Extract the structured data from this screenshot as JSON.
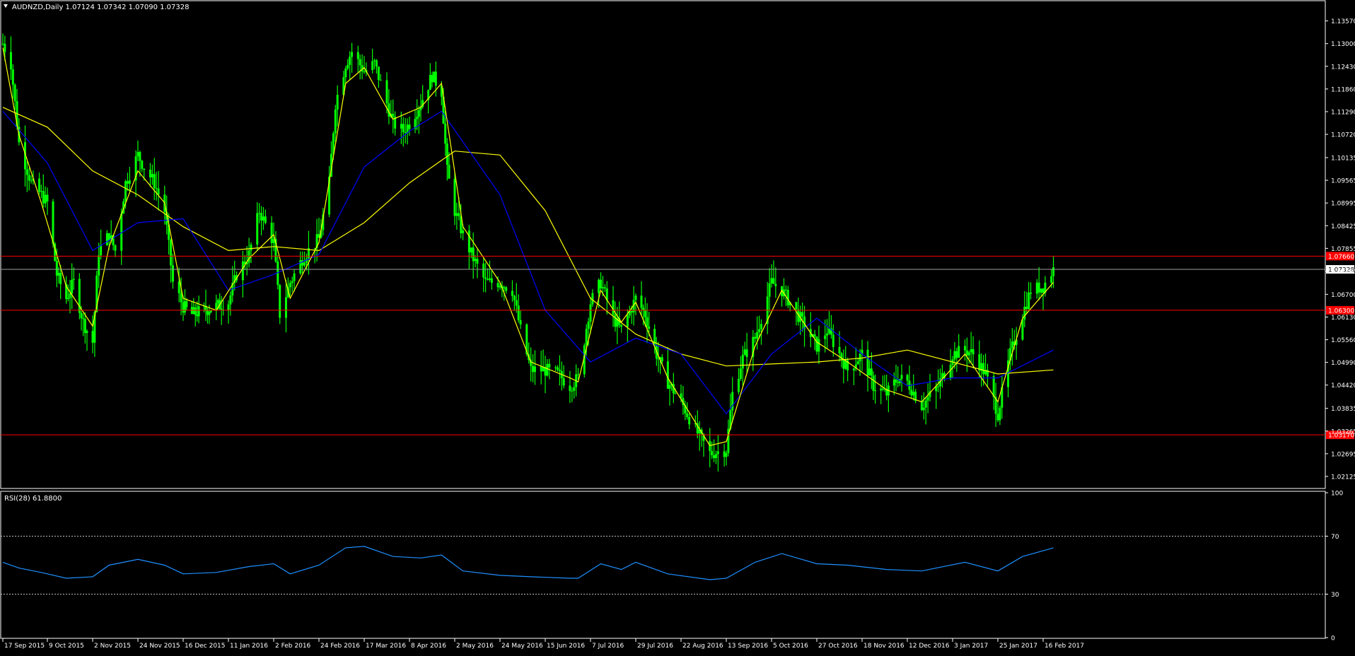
{
  "header": {
    "symbol_line": "AUDNZD,Daily  1.07124 1.07342 1.07090 1.07328"
  },
  "colors": {
    "background": "#000000",
    "frame": "#ffffff",
    "candles": "#00ff00",
    "ma_fast": "#ffff00",
    "ma_mid": "#0000ff",
    "ma_slow": "#ffff00",
    "support_resistance": "#ff0000",
    "current_price_line": "#a0a0a0",
    "rsi_line": "#1e90ff"
  },
  "chart_data": [
    {
      "type": "line",
      "title": "AUDNZD,Daily",
      "ohlc_header": {
        "open": 1.07124,
        "high": 1.07342,
        "low": 1.0709,
        "close": 1.07328
      },
      "ylim": [
        1.0184,
        1.1406
      ],
      "y_ticks": [
        "1.13570",
        "1.13000",
        "1.12430",
        "1.11860",
        "1.11290",
        "1.10720",
        "1.10135",
        "1.09565",
        "1.08995",
        "1.08425",
        "1.07855",
        "1.07285",
        "1.06700",
        "1.06130",
        "1.05560",
        "1.04990",
        "1.04420",
        "1.03835",
        "1.03265",
        "1.02695",
        "1.02125"
      ],
      "y_tick_values": [
        1.1357,
        1.13,
        1.1243,
        1.1186,
        1.1129,
        1.1072,
        1.10135,
        1.09565,
        1.08995,
        1.08425,
        1.07855,
        1.07285,
        1.067,
        1.0613,
        1.0556,
        1.0499,
        1.0442,
        1.03835,
        1.03265,
        1.02695,
        1.02125
      ],
      "x_ticks": [
        "17 Sep 2015",
        "9 Oct 2015",
        "2 Nov 2015",
        "24 Nov 2015",
        "16 Dec 2015",
        "11 Jan 2016",
        "2 Feb 2016",
        "24 Feb 2016",
        "17 Mar 2016",
        "8 Apr 2016",
        "2 May 2016",
        "24 May 2016",
        "15 Jun 2016",
        "7 Jul 2016",
        "29 Jul 2016",
        "22 Aug 2016",
        "13 Sep 2016",
        "5 Oct 2016",
        "27 Oct 2016",
        "18 Nov 2016",
        "12 Dec 2016",
        "3 Jan 2017",
        "25 Jan 2017",
        "16 Feb 2017"
      ],
      "horizontal_levels": [
        {
          "value": 1.0766,
          "label": "1.07660",
          "style": "red"
        },
        {
          "value": 1.063,
          "label": "1.06300",
          "style": "red"
        },
        {
          "value": 1.0317,
          "label": "1.03170",
          "style": "red"
        }
      ],
      "current_price": {
        "value": 1.07328,
        "label": "1.07328"
      },
      "close_series": [
        {
          "x": "17 Sep 2015",
          "y": 1.13
        },
        {
          "x": "21 Sep 2015",
          "y": 1.125
        },
        {
          "x": "25 Sep 2015",
          "y": 1.105
        },
        {
          "x": "1 Oct 2015",
          "y": 1.095
        },
        {
          "x": "6 Oct 2015",
          "y": 1.092
        },
        {
          "x": "9 Oct 2015",
          "y": 1.09
        },
        {
          "x": "14 Oct 2015",
          "y": 1.072
        },
        {
          "x": "19 Oct 2015",
          "y": 1.066
        },
        {
          "x": "23 Oct 2015",
          "y": 1.07
        },
        {
          "x": "28 Oct 2015",
          "y": 1.06
        },
        {
          "x": "2 Nov 2015",
          "y": 1.055
        },
        {
          "x": "5 Nov 2015",
          "y": 1.078
        },
        {
          "x": "10 Nov 2015",
          "y": 1.082
        },
        {
          "x": "13 Nov 2015",
          "y": 1.078
        },
        {
          "x": "18 Nov 2015",
          "y": 1.095
        },
        {
          "x": "24 Nov 2015",
          "y": 1.102
        },
        {
          "x": "27 Nov 2015",
          "y": 1.099
        },
        {
          "x": "2 Dec 2015",
          "y": 1.095
        },
        {
          "x": "7 Dec 2015",
          "y": 1.088
        },
        {
          "x": "11 Dec 2015",
          "y": 1.07
        },
        {
          "x": "16 Dec 2015",
          "y": 1.064
        },
        {
          "x": "21 Dec 2015",
          "y": 1.062
        },
        {
          "x": "28 Dec 2015",
          "y": 1.063
        },
        {
          "x": "4 Jan 2016",
          "y": 1.064
        },
        {
          "x": "11 Jan 2016",
          "y": 1.065
        },
        {
          "x": "15 Jan 2016",
          "y": 1.072
        },
        {
          "x": "21 Jan 2016",
          "y": 1.077
        },
        {
          "x": "26 Jan 2016",
          "y": 1.088
        },
        {
          "x": "2 Feb 2016",
          "y": 1.08
        },
        {
          "x": "5 Feb 2016",
          "y": 1.062
        },
        {
          "x": "10 Feb 2016",
          "y": 1.07
        },
        {
          "x": "16 Feb 2016",
          "y": 1.076
        },
        {
          "x": "19 Feb 2016",
          "y": 1.078
        },
        {
          "x": "24 Feb 2016",
          "y": 1.081
        },
        {
          "x": "29 Feb 2016",
          "y": 1.095
        },
        {
          "x": "3 Mar 2016",
          "y": 1.115
        },
        {
          "x": "8 Mar 2016",
          "y": 1.125
        },
        {
          "x": "11 Mar 2016",
          "y": 1.128
        },
        {
          "x": "17 Mar 2016",
          "y": 1.123
        },
        {
          "x": "22 Mar 2016",
          "y": 1.125
        },
        {
          "x": "28 Mar 2016",
          "y": 1.115
        },
        {
          "x": "31 Mar 2016",
          "y": 1.11
        },
        {
          "x": "5 Apr 2016",
          "y": 1.108
        },
        {
          "x": "8 Apr 2016",
          "y": 1.11
        },
        {
          "x": "14 Apr 2016",
          "y": 1.115
        },
        {
          "x": "20 Apr 2016",
          "y": 1.122
        },
        {
          "x": "25 Apr 2016",
          "y": 1.118
        },
        {
          "x": "28 Apr 2016",
          "y": 1.098
        },
        {
          "x": "2 May 2016",
          "y": 1.088
        },
        {
          "x": "6 May 2016",
          "y": 1.082
        },
        {
          "x": "11 May 2016",
          "y": 1.076
        },
        {
          "x": "17 May 2016",
          "y": 1.07
        },
        {
          "x": "24 May 2016",
          "y": 1.07
        },
        {
          "x": "30 May 2016",
          "y": 1.068
        },
        {
          "x": "3 Jun 2016",
          "y": 1.058
        },
        {
          "x": "8 Jun 2016",
          "y": 1.048
        },
        {
          "x": "15 Jun 2016",
          "y": 1.048
        },
        {
          "x": "21 Jun 2016",
          "y": 1.047
        },
        {
          "x": "27 Jun 2016",
          "y": 1.044
        },
        {
          "x": "1 Jul 2016",
          "y": 1.046
        },
        {
          "x": "7 Jul 2016",
          "y": 1.065
        },
        {
          "x": "12 Jul 2016",
          "y": 1.07
        },
        {
          "x": "18 Jul 2016",
          "y": 1.061
        },
        {
          "x": "22 Jul 2016",
          "y": 1.058
        },
        {
          "x": "29 Jul 2016",
          "y": 1.066
        },
        {
          "x": "3 Aug 2016",
          "y": 1.062
        },
        {
          "x": "9 Aug 2016",
          "y": 1.052
        },
        {
          "x": "15 Aug 2016",
          "y": 1.045
        },
        {
          "x": "22 Aug 2016",
          "y": 1.04
        },
        {
          "x": "29 Aug 2016",
          "y": 1.033
        },
        {
          "x": "5 Sep 2016",
          "y": 1.027
        },
        {
          "x": "13 Sep 2016",
          "y": 1.028
        },
        {
          "x": "16 Sep 2016",
          "y": 1.042
        },
        {
          "x": "21 Sep 2016",
          "y": 1.051
        },
        {
          "x": "27 Sep 2016",
          "y": 1.056
        },
        {
          "x": "5 Oct 2016",
          "y": 1.07
        },
        {
          "x": "10 Oct 2016",
          "y": 1.068
        },
        {
          "x": "14 Oct 2016",
          "y": 1.065
        },
        {
          "x": "20 Oct 2016",
          "y": 1.06
        },
        {
          "x": "27 Oct 2016",
          "y": 1.054
        },
        {
          "x": "1 Nov 2016",
          "y": 1.058
        },
        {
          "x": "7 Nov 2016",
          "y": 1.052
        },
        {
          "x": "11 Nov 2016",
          "y": 1.048
        },
        {
          "x": "18 Nov 2016",
          "y": 1.052
        },
        {
          "x": "24 Nov 2016",
          "y": 1.044
        },
        {
          "x": "1 Dec 2016",
          "y": 1.042
        },
        {
          "x": "7 Dec 2016",
          "y": 1.046
        },
        {
          "x": "12 Dec 2016",
          "y": 1.045
        },
        {
          "x": "19 Dec 2016",
          "y": 1.039
        },
        {
          "x": "27 Dec 2016",
          "y": 1.044
        },
        {
          "x": "3 Jan 2017",
          "y": 1.052
        },
        {
          "x": "9 Jan 2017",
          "y": 1.053
        },
        {
          "x": "13 Jan 2017",
          "y": 1.052
        },
        {
          "x": "19 Jan 2017",
          "y": 1.047
        },
        {
          "x": "25 Jan 2017",
          "y": 1.037
        },
        {
          "x": "31 Jan 2017",
          "y": 1.052
        },
        {
          "x": "6 Feb 2017",
          "y": 1.062
        },
        {
          "x": "10 Feb 2017",
          "y": 1.068
        },
        {
          "x": "16 Feb 2017",
          "y": 1.069
        },
        {
          "x": "21 Feb 2017",
          "y": 1.0733
        }
      ],
      "ma_fast": [
        {
          "x": "17 Sep 2015",
          "y": 1.129
        },
        {
          "x": "25 Sep 2015",
          "y": 1.107
        },
        {
          "x": "6 Oct 2015",
          "y": 1.09
        },
        {
          "x": "19 Oct 2015",
          "y": 1.069
        },
        {
          "x": "2 Nov 2015",
          "y": 1.059
        },
        {
          "x": "10 Nov 2015",
          "y": 1.079
        },
        {
          "x": "24 Nov 2015",
          "y": 1.098
        },
        {
          "x": "7 Dec 2015",
          "y": 1.09
        },
        {
          "x": "16 Dec 2015",
          "y": 1.066
        },
        {
          "x": "4 Jan 2016",
          "y": 1.063
        },
        {
          "x": "21 Jan 2016",
          "y": 1.076
        },
        {
          "x": "2 Feb 2016",
          "y": 1.082
        },
        {
          "x": "10 Feb 2016",
          "y": 1.066
        },
        {
          "x": "24 Feb 2016",
          "y": 1.08
        },
        {
          "x": "8 Mar 2016",
          "y": 1.12
        },
        {
          "x": "17 Mar 2016",
          "y": 1.124
        },
        {
          "x": "31 Mar 2016",
          "y": 1.111
        },
        {
          "x": "14 Apr 2016",
          "y": 1.114
        },
        {
          "x": "25 Apr 2016",
          "y": 1.12
        },
        {
          "x": "6 May 2016",
          "y": 1.084
        },
        {
          "x": "24 May 2016",
          "y": 1.07
        },
        {
          "x": "8 Jun 2016",
          "y": 1.05
        },
        {
          "x": "27 Jun 2016",
          "y": 1.046
        },
        {
          "x": "1 Jul 2016",
          "y": 1.045
        },
        {
          "x": "12 Jul 2016",
          "y": 1.068
        },
        {
          "x": "22 Jul 2016",
          "y": 1.06
        },
        {
          "x": "29 Jul 2016",
          "y": 1.065
        },
        {
          "x": "15 Aug 2016",
          "y": 1.046
        },
        {
          "x": "5 Sep 2016",
          "y": 1.029
        },
        {
          "x": "13 Sep 2016",
          "y": 1.03
        },
        {
          "x": "27 Sep 2016",
          "y": 1.054
        },
        {
          "x": "10 Oct 2016",
          "y": 1.068
        },
        {
          "x": "27 Oct 2016",
          "y": 1.055
        },
        {
          "x": "11 Nov 2016",
          "y": 1.05
        },
        {
          "x": "1 Dec 2016",
          "y": 1.043
        },
        {
          "x": "19 Dec 2016",
          "y": 1.04
        },
        {
          "x": "9 Jan 2017",
          "y": 1.052
        },
        {
          "x": "25 Jan 2017",
          "y": 1.04
        },
        {
          "x": "6 Feb 2017",
          "y": 1.061
        },
        {
          "x": "21 Feb 2017",
          "y": 1.07
        }
      ],
      "ma_mid": [
        {
          "x": "17 Sep 2015",
          "y": 1.113
        },
        {
          "x": "9 Oct 2015",
          "y": 1.1
        },
        {
          "x": "2 Nov 2015",
          "y": 1.078
        },
        {
          "x": "24 Nov 2015",
          "y": 1.085
        },
        {
          "x": "16 Dec 2015",
          "y": 1.086
        },
        {
          "x": "11 Jan 2016",
          "y": 1.068
        },
        {
          "x": "2 Feb 2016",
          "y": 1.072
        },
        {
          "x": "24 Feb 2016",
          "y": 1.077
        },
        {
          "x": "17 Mar 2016",
          "y": 1.099
        },
        {
          "x": "8 Apr 2016",
          "y": 1.108
        },
        {
          "x": "25 Apr 2016",
          "y": 1.113
        },
        {
          "x": "24 May 2016",
          "y": 1.092
        },
        {
          "x": "15 Jun 2016",
          "y": 1.063
        },
        {
          "x": "7 Jul 2016",
          "y": 1.05
        },
        {
          "x": "29 Jul 2016",
          "y": 1.056
        },
        {
          "x": "22 Aug 2016",
          "y": 1.052
        },
        {
          "x": "13 Sep 2016",
          "y": 1.037
        },
        {
          "x": "5 Oct 2016",
          "y": 1.052
        },
        {
          "x": "27 Oct 2016",
          "y": 1.061
        },
        {
          "x": "18 Nov 2016",
          "y": 1.052
        },
        {
          "x": "12 Dec 2016",
          "y": 1.044
        },
        {
          "x": "3 Jan 2017",
          "y": 1.046
        },
        {
          "x": "25 Jan 2017",
          "y": 1.046
        },
        {
          "x": "21 Feb 2017",
          "y": 1.053
        }
      ],
      "ma_slow": [
        {
          "x": "17 Sep 2015",
          "y": 1.114
        },
        {
          "x": "9 Oct 2015",
          "y": 1.109
        },
        {
          "x": "2 Nov 2015",
          "y": 1.098
        },
        {
          "x": "24 Nov 2015",
          "y": 1.092
        },
        {
          "x": "16 Dec 2015",
          "y": 1.084
        },
        {
          "x": "11 Jan 2016",
          "y": 1.078
        },
        {
          "x": "2 Feb 2016",
          "y": 1.079
        },
        {
          "x": "24 Feb 2016",
          "y": 1.078
        },
        {
          "x": "17 Mar 2016",
          "y": 1.085
        },
        {
          "x": "8 Apr 2016",
          "y": 1.095
        },
        {
          "x": "2 May 2016",
          "y": 1.103
        },
        {
          "x": "24 May 2016",
          "y": 1.102
        },
        {
          "x": "15 Jun 2016",
          "y": 1.088
        },
        {
          "x": "7 Jul 2016",
          "y": 1.066
        },
        {
          "x": "29 Jul 2016",
          "y": 1.057
        },
        {
          "x": "22 Aug 2016",
          "y": 1.052
        },
        {
          "x": "13 Sep 2016",
          "y": 1.049
        },
        {
          "x": "5 Oct 2016",
          "y": 1.0495
        },
        {
          "x": "27 Oct 2016",
          "y": 1.05
        },
        {
          "x": "18 Nov 2016",
          "y": 1.051
        },
        {
          "x": "12 Dec 2016",
          "y": 1.053
        },
        {
          "x": "3 Jan 2017",
          "y": 1.05
        },
        {
          "x": "25 Jan 2017",
          "y": 1.047
        },
        {
          "x": "21 Feb 2017",
          "y": 1.048
        }
      ]
    },
    {
      "type": "line",
      "title": "RSI(28) 61.8800",
      "ylim": [
        0,
        100
      ],
      "y_ticks": [
        "100",
        "70",
        "30",
        "0"
      ],
      "y_tick_values": [
        100,
        70,
        30,
        0
      ],
      "reference_levels": [
        70,
        30
      ],
      "series": [
        {
          "name": "RSI(28)",
          "values": [
            {
              "x": "17 Sep 2015",
              "y": 52
            },
            {
              "x": "25 Sep 2015",
              "y": 48
            },
            {
              "x": "6 Oct 2015",
              "y": 45
            },
            {
              "x": "19 Oct 2015",
              "y": 41
            },
            {
              "x": "2 Nov 2015",
              "y": 42
            },
            {
              "x": "10 Nov 2015",
              "y": 50
            },
            {
              "x": "24 Nov 2015",
              "y": 54
            },
            {
              "x": "7 Dec 2015",
              "y": 50
            },
            {
              "x": "16 Dec 2015",
              "y": 44
            },
            {
              "x": "4 Jan 2016",
              "y": 45
            },
            {
              "x": "21 Jan 2016",
              "y": 49
            },
            {
              "x": "2 Feb 2016",
              "y": 51
            },
            {
              "x": "10 Feb 2016",
              "y": 44
            },
            {
              "x": "24 Feb 2016",
              "y": 50
            },
            {
              "x": "8 Mar 2016",
              "y": 62
            },
            {
              "x": "17 Mar 2016",
              "y": 63
            },
            {
              "x": "31 Mar 2016",
              "y": 56
            },
            {
              "x": "14 Apr 2016",
              "y": 55
            },
            {
              "x": "25 Apr 2016",
              "y": 57
            },
            {
              "x": "6 May 2016",
              "y": 46
            },
            {
              "x": "24 May 2016",
              "y": 43
            },
            {
              "x": "8 Jun 2016",
              "y": 42
            },
            {
              "x": "27 Jun 2016",
              "y": 41
            },
            {
              "x": "1 Jul 2016",
              "y": 41
            },
            {
              "x": "12 Jul 2016",
              "y": 51
            },
            {
              "x": "22 Jul 2016",
              "y": 47
            },
            {
              "x": "29 Jul 2016",
              "y": 52
            },
            {
              "x": "15 Aug 2016",
              "y": 44
            },
            {
              "x": "5 Sep 2016",
              "y": 40
            },
            {
              "x": "13 Sep 2016",
              "y": 41
            },
            {
              "x": "27 Sep 2016",
              "y": 52
            },
            {
              "x": "10 Oct 2016",
              "y": 58
            },
            {
              "x": "27 Oct 2016",
              "y": 51
            },
            {
              "x": "11 Nov 2016",
              "y": 50
            },
            {
              "x": "1 Dec 2016",
              "y": 47
            },
            {
              "x": "19 Dec 2016",
              "y": 46
            },
            {
              "x": "9 Jan 2017",
              "y": 52
            },
            {
              "x": "25 Jan 2017",
              "y": 46
            },
            {
              "x": "6 Feb 2017",
              "y": 56
            },
            {
              "x": "21 Feb 2017",
              "y": 61.88
            }
          ]
        }
      ]
    }
  ]
}
